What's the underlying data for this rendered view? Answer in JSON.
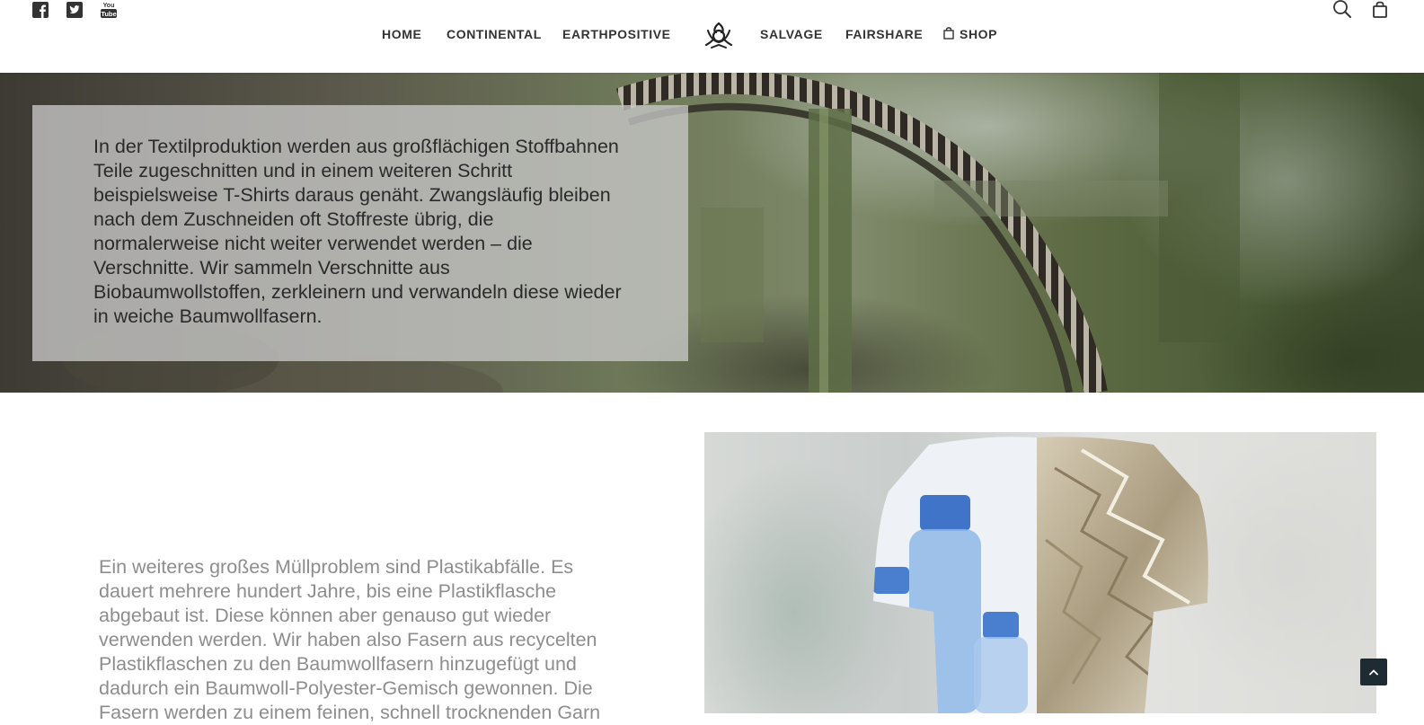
{
  "header": {
    "social": [
      {
        "icon": "facebook-icon"
      },
      {
        "icon": "twitter-icon"
      },
      {
        "icon": "youtube-icon"
      }
    ],
    "nav": [
      {
        "label": "HOME"
      },
      {
        "label": "CONTINENTAL"
      },
      {
        "label": "EARTHPOSITIVE"
      },
      {
        "label": "SALVAGE"
      },
      {
        "label": "FAIRSHARE"
      },
      {
        "label": "SHOP",
        "icon": "shopping-bag-icon"
      }
    ],
    "logo": {
      "icon": "logo-icon"
    },
    "right_icons": [
      {
        "icon": "search-icon"
      },
      {
        "icon": "cart-icon"
      }
    ]
  },
  "hero": {
    "text": "In der Textilproduktion werden aus großflächigen Stoffbahnen Teile zugeschnitten und in einem weiteren Schritt beispielsweise T-Shirts daraus genäht. Zwangsläufig bleiben nach dem Zuschneiden oft Stoffreste übrig, die normalerweise nicht weiter verwendet werden – die Verschnitte. Wir sammeln Verschnitte aus Biobaumwollstoffen, zerkleinern und verwandeln diese wieder in weiche Baumwollfasern."
  },
  "section2": {
    "text": "Ein weiteres großes Müllproblem sind Plastikabfälle. Es dauert mehrere hundert Jahre, bis eine Plastikflasche abgebaut ist. Diese können aber genauso gut wieder verwenden werden. Wir haben also Fasern aus recycelten Plastikflaschen zu den Baumwollfasern hinzugefügt und dadurch ein Baumwoll-Polyester-Gemisch gewonnen. Die Fasern werden zu einem feinen, schnell trocknenden Garn"
  },
  "back_to_top": {
    "icon": "chevron-up-icon"
  }
}
